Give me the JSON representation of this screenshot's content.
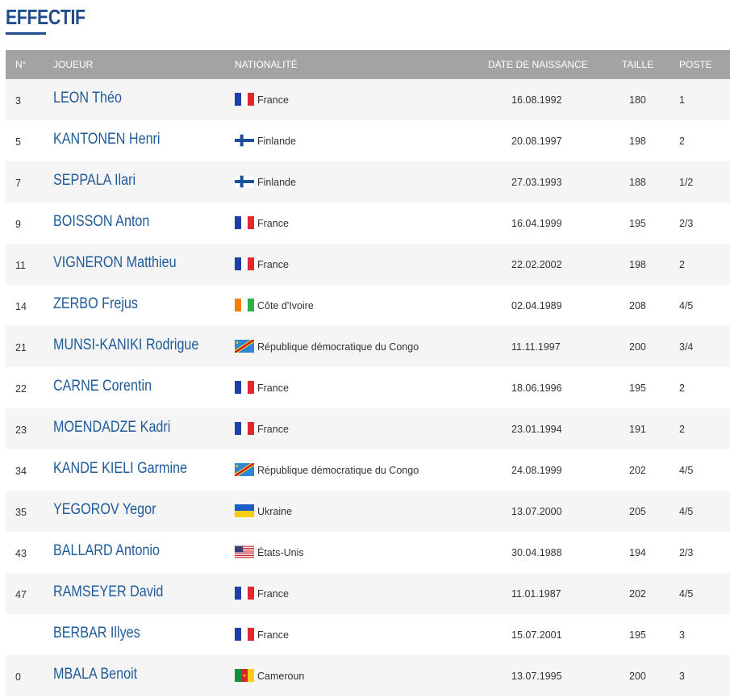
{
  "page": {
    "title": "EFFECTIF"
  },
  "table": {
    "headers": {
      "num": "N°",
      "player": "JOUEUR",
      "nationality": "NATIONALITÉ",
      "dob": "DATE DE NAISSANCE",
      "height": "TAILLE",
      "position": "POSTE"
    },
    "rows": [
      {
        "num": "3",
        "name": "LEON Théo",
        "flag": "france-flag-icon",
        "country": "France",
        "dob": "16.08.1992",
        "height": "180",
        "position": "1"
      },
      {
        "num": "5",
        "name": "KANTONEN Henri",
        "flag": "finland-flag-icon",
        "country": "Finlande",
        "dob": "20.08.1997",
        "height": "198",
        "position": "2"
      },
      {
        "num": "7",
        "name": "SEPPALA Ilari",
        "flag": "finland-flag-icon",
        "country": "Finlande",
        "dob": "27.03.1993",
        "height": "188",
        "position": "1/2"
      },
      {
        "num": "9",
        "name": "BOISSON Anton",
        "flag": "france-flag-icon",
        "country": "France",
        "dob": "16.04.1999",
        "height": "195",
        "position": "2/3"
      },
      {
        "num": "11",
        "name": "VIGNERON Matthieu",
        "flag": "france-flag-icon",
        "country": "France",
        "dob": "22.02.2002",
        "height": "198",
        "position": "2"
      },
      {
        "num": "14",
        "name": "ZERBO Frejus",
        "flag": "ivory-coast-flag-icon",
        "country": "Côte d'Ivoire",
        "dob": "02.04.1989",
        "height": "208",
        "position": "4/5"
      },
      {
        "num": "21",
        "name": "MUNSI-KANIKI Rodrigue",
        "flag": "dr-congo-flag-icon",
        "country": "République démocratique du Congo",
        "dob": "11.11.1997",
        "height": "200",
        "position": "3/4"
      },
      {
        "num": "22",
        "name": "CARNE Corentin",
        "flag": "france-flag-icon",
        "country": "France",
        "dob": "18.06.1996",
        "height": "195",
        "position": "2"
      },
      {
        "num": "23",
        "name": "MOENDADZE Kadri",
        "flag": "france-flag-icon",
        "country": "France",
        "dob": "23.01.1994",
        "height": "191",
        "position": "2"
      },
      {
        "num": "34",
        "name": "KANDE KIELI Garmine",
        "flag": "dr-congo-flag-icon",
        "country": "République démocratique du Congo",
        "dob": "24.08.1999",
        "height": "202",
        "position": "4/5"
      },
      {
        "num": "35",
        "name": "YEGOROV Yegor",
        "flag": "ukraine-flag-icon",
        "country": "Ukraine",
        "dob": "13.07.2000",
        "height": "205",
        "position": "4/5"
      },
      {
        "num": "43",
        "name": "BALLARD Antonio",
        "flag": "usa-flag-icon",
        "country": "États-Unis",
        "dob": "30.04.1988",
        "height": "194",
        "position": "2/3"
      },
      {
        "num": "47",
        "name": "RAMSEYER David",
        "flag": "france-flag-icon",
        "country": "France",
        "dob": "11.01.1987",
        "height": "202",
        "position": "4/5"
      },
      {
        "num": "",
        "name": "BERBAR Illyes",
        "flag": "france-flag-icon",
        "country": "France",
        "dob": "15.07.2001",
        "height": "195",
        "position": "3"
      },
      {
        "num": "0",
        "name": "MBALA Benoit",
        "flag": "cameroon-flag-icon",
        "country": "Cameroun",
        "dob": "13.07.1995",
        "height": "200",
        "position": "3"
      }
    ]
  },
  "colors": {
    "title": "#1f4e8c",
    "header_bg": "#a3a3a3",
    "row_alt": "#f5f5f5",
    "player_link": "#1f5a99"
  }
}
